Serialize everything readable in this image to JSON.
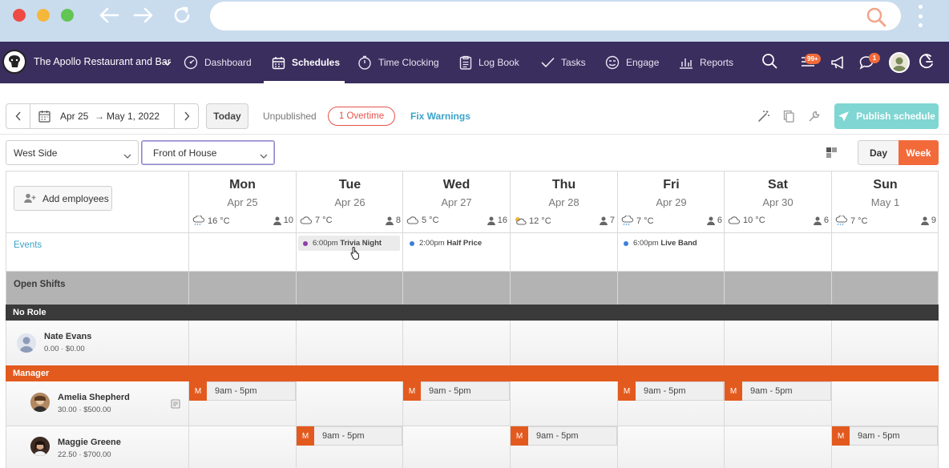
{
  "browser": {
    "url": ""
  },
  "venue": {
    "name": "The Apollo Restaurant and Bar"
  },
  "nav": {
    "dashboard": "Dashboard",
    "schedules": "Schedules",
    "time_clocking": "Time Clocking",
    "log_book": "Log Book",
    "tasks": "Tasks",
    "engage": "Engage",
    "reports": "Reports"
  },
  "badges": {
    "notifications": "99+",
    "messages": "1"
  },
  "toolbar": {
    "date_from": "Apr 25",
    "date_arrow": "→",
    "date_to": "May 1, 2022",
    "today": "Today",
    "unpublished": "Unpublished",
    "overtime": "1 Overtime",
    "fix_warnings": "Fix Warnings",
    "publish": "Publish schedule"
  },
  "filters": {
    "location": "West Side",
    "department": "Front of House",
    "view_day": "Day",
    "view_week": "Week"
  },
  "grid": {
    "add_employees": "Add employees",
    "events_label": "Events",
    "open_shifts_label": "Open Shifts",
    "days": [
      {
        "name": "Mon",
        "date": "Apr 25",
        "weather": "16 °C",
        "staff": "10"
      },
      {
        "name": "Tue",
        "date": "Apr 26",
        "weather": "7 °C",
        "staff": "8"
      },
      {
        "name": "Wed",
        "date": "Apr 27",
        "weather": "5 °C",
        "staff": "16"
      },
      {
        "name": "Thu",
        "date": "Apr 28",
        "weather": "12 °C",
        "staff": "7"
      },
      {
        "name": "Fri",
        "date": "Apr 29",
        "weather": "7 °C",
        "staff": "6"
      },
      {
        "name": "Sat",
        "date": "Apr 30",
        "weather": "10 °C",
        "staff": "6"
      },
      {
        "name": "Sun",
        "date": "May 1",
        "weather": "7 °C",
        "staff": "9"
      }
    ],
    "events": [
      {
        "time": "6:00pm",
        "title": "Trivia Night",
        "color": "#8e3fa8"
      },
      {
        "time": "2:00pm",
        "title": "Half Price",
        "color": "#3b7fd9"
      },
      {
        "time": "6:00pm",
        "title": "Live Band",
        "color": "#3b7fd9"
      }
    ],
    "roles": {
      "no_role": "No Role",
      "manager": "Manager"
    },
    "employees": [
      {
        "name": "Nate Evans",
        "pay": "0.00 · $0.00"
      },
      {
        "name": "Amelia Shepherd",
        "pay": "30.00 · $500.00"
      },
      {
        "name": "Maggie Greene",
        "pay": "22.50 · $700.00"
      }
    ],
    "shift_tag": "M",
    "shift_time": "9am - 5pm"
  },
  "colors": {
    "brand": "#3a2e5e",
    "accent": "#f26a3a",
    "manager": "#e35a1e",
    "link": "#3aa3c9",
    "publish": "#7fd6d2"
  }
}
